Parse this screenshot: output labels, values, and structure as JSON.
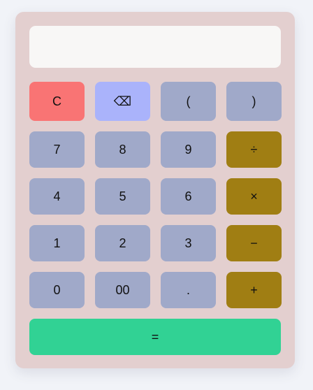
{
  "display": {
    "value": ""
  },
  "keys": {
    "clear": "C",
    "backspace": "⌫",
    "open_paren": "(",
    "close_paren": ")",
    "seven": "7",
    "eight": "8",
    "nine": "9",
    "divide": "÷",
    "four": "4",
    "five": "5",
    "six": "6",
    "multiply": "×",
    "one": "1",
    "two": "2",
    "three": "3",
    "subtract": "−",
    "zero": "0",
    "double_zero": "00",
    "decimal": ".",
    "add": "+",
    "equals": "="
  },
  "colors": {
    "panel": "#e3cfcf",
    "display": "#f8f7f6",
    "number_key": "#a0a9c9",
    "clear_key": "#f97474",
    "backspace_key": "#aab3fb",
    "operator_key": "#a07e13",
    "equals_key": "#31d294",
    "page_background": "#f1f3f8"
  }
}
